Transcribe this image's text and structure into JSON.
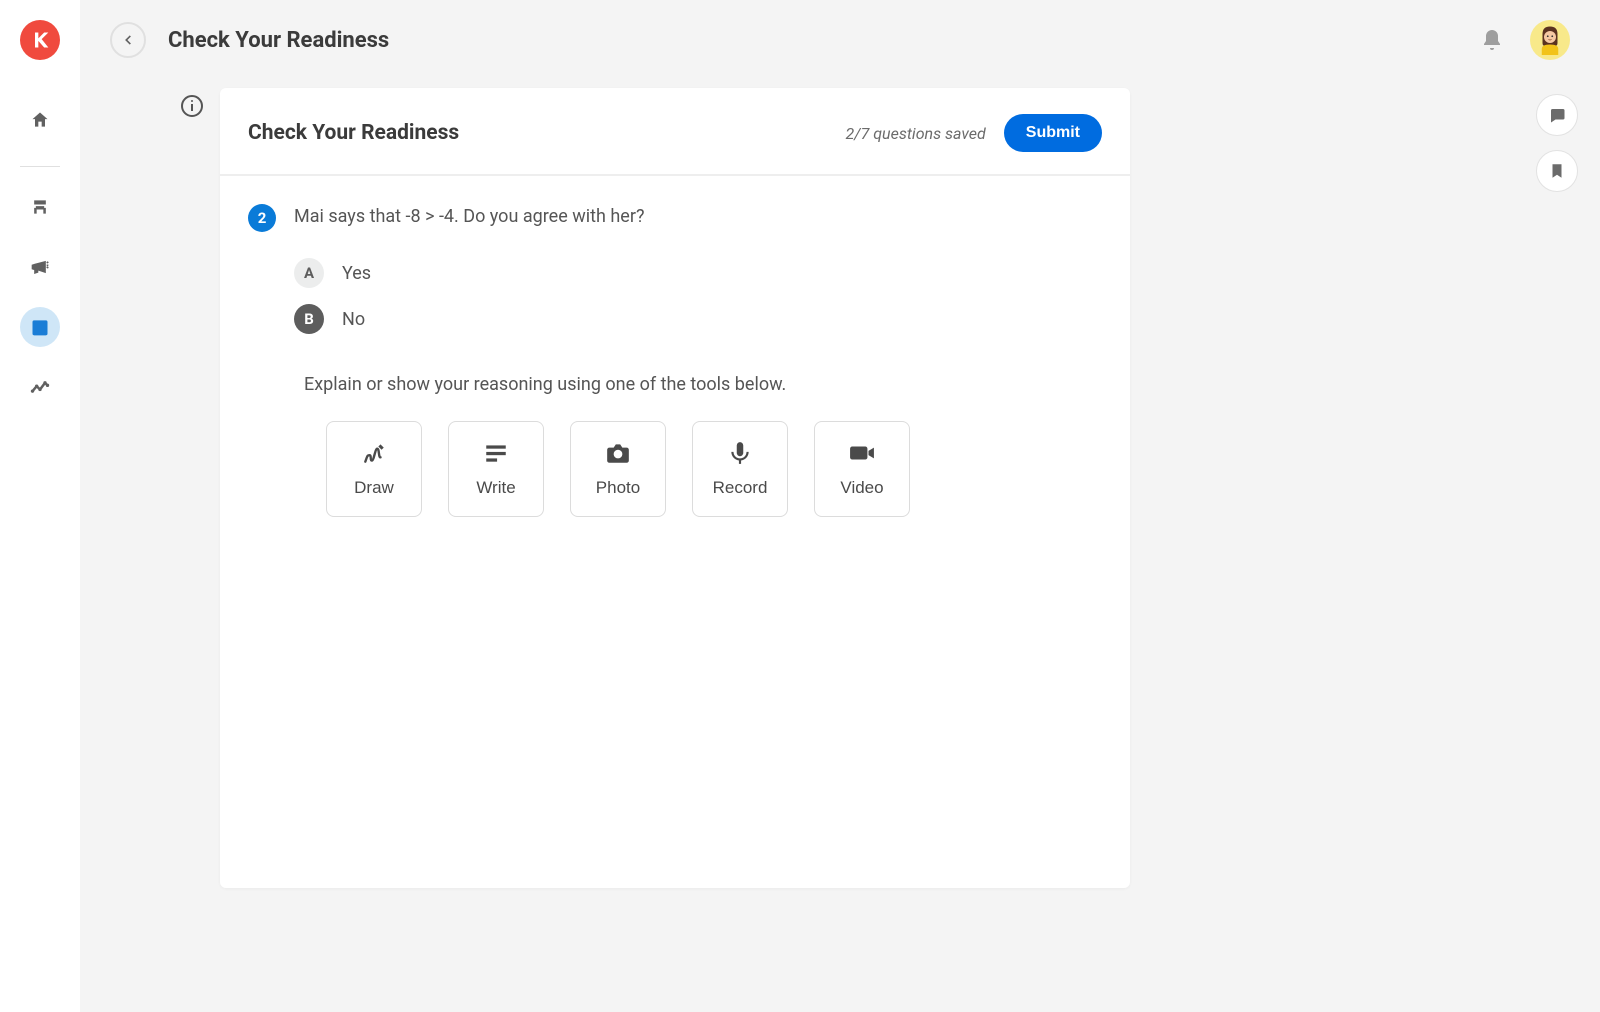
{
  "header": {
    "title": "Check Your Readiness"
  },
  "card": {
    "title": "Check Your Readiness",
    "saveStatus": "2/7 questions saved",
    "submitLabel": "Submit"
  },
  "question": {
    "number": "2",
    "text": "Mai says that -8 > -4. Do you agree with her?",
    "options": [
      {
        "letter": "A",
        "label": "Yes",
        "selected": false
      },
      {
        "letter": "B",
        "label": "No",
        "selected": true
      }
    ],
    "explain": "Explain or show your reasoning using one of the tools below."
  },
  "tools": [
    {
      "id": "draw",
      "label": "Draw"
    },
    {
      "id": "write",
      "label": "Write"
    },
    {
      "id": "photo",
      "label": "Photo"
    },
    {
      "id": "record",
      "label": "Record"
    },
    {
      "id": "video",
      "label": "Video"
    }
  ],
  "sidebar": {
    "items": [
      "home",
      "desk",
      "announce",
      "calendar",
      "analytics"
    ],
    "activeIndex": 3
  }
}
